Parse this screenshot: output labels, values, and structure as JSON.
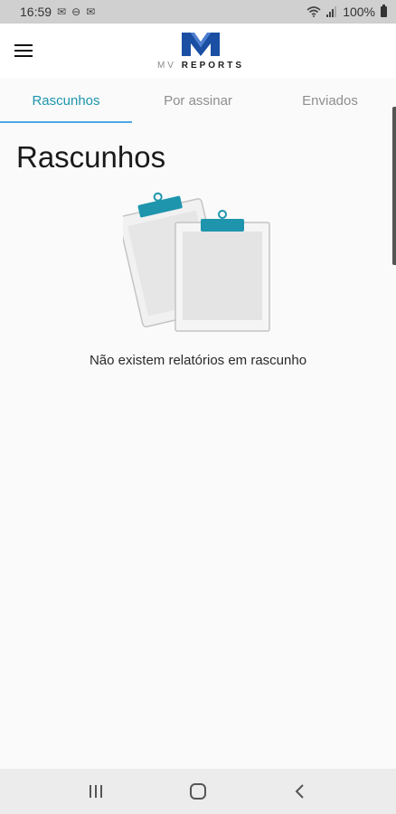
{
  "status_bar": {
    "time": "16:59",
    "left_icons": [
      "mail-icon",
      "do-not-disturb-icon",
      "mail-icon"
    ],
    "battery": "100%",
    "right_icons": [
      "wifi-icon",
      "signal-icon",
      "battery-icon"
    ]
  },
  "header": {
    "menu_icon": "hamburger-menu-icon",
    "logo_mv": "MV",
    "logo_reports": "REPORTS",
    "logo_color": "#1a4fa3"
  },
  "tabs": [
    {
      "label": "Rascunhos",
      "active": true
    },
    {
      "label": "Por assinar",
      "active": false
    },
    {
      "label": "Enviados",
      "active": false
    }
  ],
  "accent_color": "#1e95ad",
  "main": {
    "title": "Rascunhos",
    "empty_icon": "clipboards-icon",
    "empty_message": "Não existem relatórios em rascunho"
  },
  "nav_bar": {
    "icons": [
      "recent-apps-icon",
      "home-icon",
      "back-icon"
    ]
  }
}
